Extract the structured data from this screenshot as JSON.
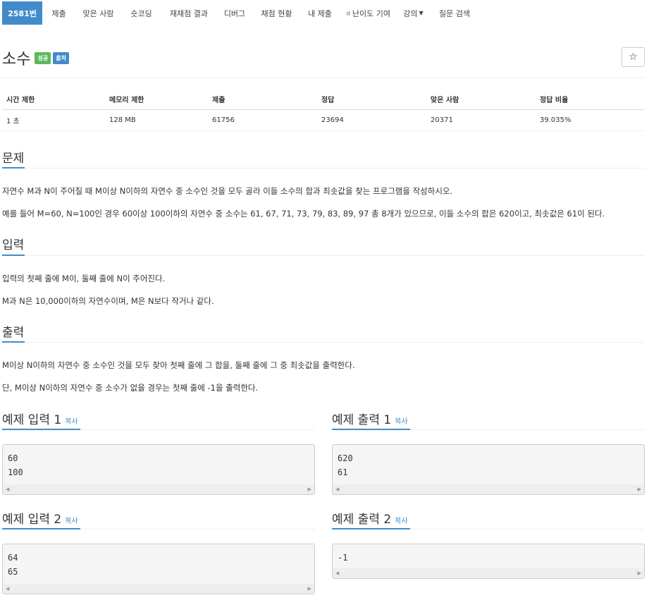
{
  "nav": {
    "items": [
      {
        "label": "2581번",
        "active": true
      },
      {
        "label": "제출"
      },
      {
        "label": "맞은 사람"
      },
      {
        "label": "숏코딩"
      },
      {
        "label": "재채점 결과"
      },
      {
        "label": "디버그"
      },
      {
        "label": "채점 현황"
      },
      {
        "label": "내 제출"
      },
      {
        "label": "난이도 기여",
        "icon": "external-link-icon"
      },
      {
        "label": "강의",
        "dropdown": true
      },
      {
        "label": "질문 검색"
      }
    ]
  },
  "problem": {
    "title": "소수",
    "badges": [
      "성공",
      "출처"
    ],
    "star_icon": "☆"
  },
  "info_table": {
    "headers": [
      "시간 제한",
      "메모리 제한",
      "제출",
      "정답",
      "맞은 사람",
      "정답 비율"
    ],
    "values": [
      "1 초",
      "128 MB",
      "61756",
      "23694",
      "20371",
      "39.035%"
    ]
  },
  "sections": {
    "description": {
      "heading": "문제",
      "paragraphs": [
        "자연수 M과 N이 주어질 때 M이상 N이하의 자연수 중 소수인 것을 모두 골라 이들 소수의 합과 최솟값을 찾는 프로그램을 작성하시오.",
        "예를 들어 M=60, N=100인 경우 60이상 100이하의 자연수 중 소수는 61, 67, 71, 73, 79, 83, 89, 97 총 8개가 있으므로, 이들 소수의 합은 620이고, 최솟값은 61이 된다."
      ]
    },
    "input": {
      "heading": "입력",
      "paragraphs": [
        "입력의 첫째 줄에 M이, 둘째 줄에 N이 주어진다.",
        "M과 N은 10,000이하의 자연수이며, M은 N보다 작거나 같다."
      ]
    },
    "output": {
      "heading": "출력",
      "paragraphs": [
        "M이상 N이하의 자연수 중 소수인 것을 모두 찾아 첫째 줄에 그 합을, 둘째 줄에 그 중 최솟값을 출력한다.",
        "단, M이상 N이하의 자연수 중 소수가 없을 경우는 첫째 줄에 -1을 출력한다."
      ]
    }
  },
  "samples": {
    "copy_label": "복사",
    "input1": {
      "heading": "예제 입력 1",
      "content": "60\n100"
    },
    "output1": {
      "heading": "예제 출력 1",
      "content": "620\n61"
    },
    "input2": {
      "heading": "예제 입력 2",
      "content": "64\n65"
    },
    "output2": {
      "heading": "예제 출력 2",
      "content": "-1"
    }
  }
}
